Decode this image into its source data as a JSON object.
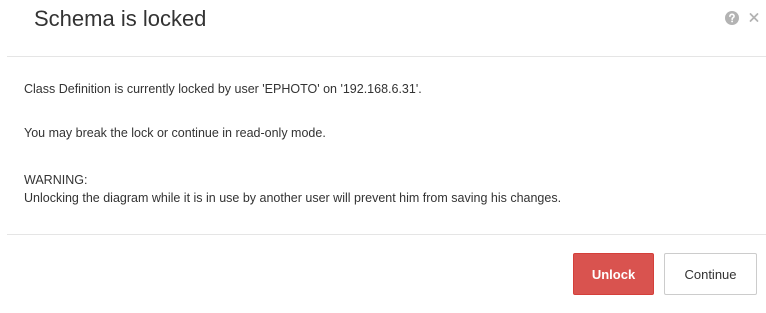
{
  "dialog": {
    "title": "Schema is locked",
    "help_icon": "question-circle-icon",
    "close_icon": "close-icon"
  },
  "body": {
    "lock_message": "Class Definition is currently locked by user 'EPHOTO' on '192.168.6.31'.",
    "options_message": "You may break the lock or continue in read-only mode.",
    "warning_label": "WARNING:",
    "warning_message": "Unlocking the diagram while it is in use by another user will prevent him from saving his changes."
  },
  "footer": {
    "unlock_label": "Unlock",
    "continue_label": "Continue"
  },
  "colors": {
    "danger": "#d9534f",
    "icon_gray": "#b3b3b3",
    "text": "#333333",
    "divider": "#e5e5e5"
  }
}
